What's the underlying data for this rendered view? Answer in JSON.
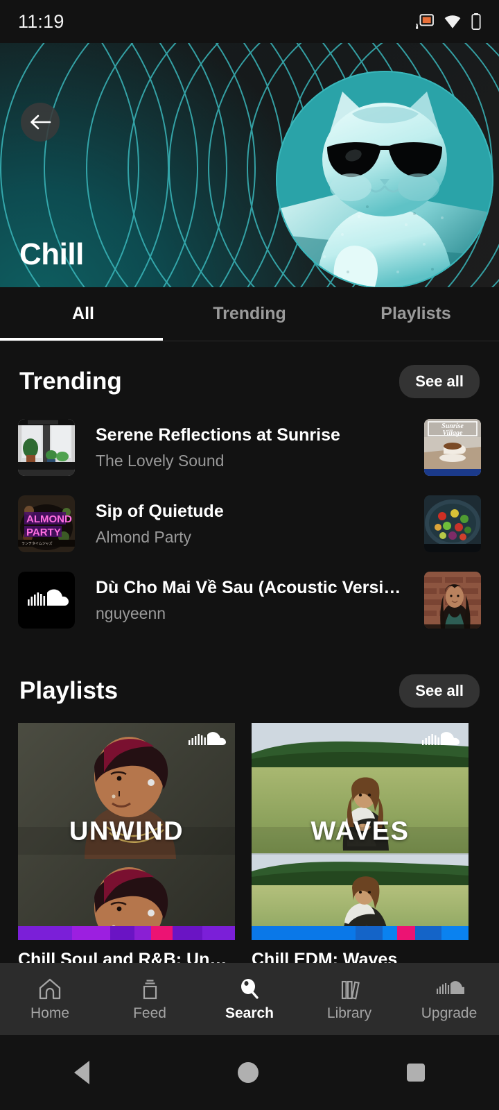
{
  "status_bar": {
    "time": "11:19",
    "icons": [
      "cast-icon",
      "wifi-icon",
      "battery-icon"
    ],
    "cast_color": "#e8703a"
  },
  "hero": {
    "title": "Chill",
    "back_icon": "back-arrow-icon",
    "accent_color": "#2aa3a8",
    "gradient_color": "#0d4b50",
    "artwork_alt": "cool-cat-with-sunglasses"
  },
  "tabs": [
    {
      "label": "All",
      "active": true
    },
    {
      "label": "Trending",
      "active": false
    },
    {
      "label": "Playlists",
      "active": false
    }
  ],
  "trending": {
    "title": "Trending",
    "see_all_label": "See all",
    "tracks": [
      {
        "title": "Serene Reflections at Sunrise",
        "artist": "The Lovely Sound",
        "left_art": "window-plants-artwork",
        "right_art": "sunrise-village-coffee-artwork"
      },
      {
        "title": "Sip of Quietude",
        "artist": "Almond Party",
        "left_art": "almond-party-artwork",
        "right_art": "salad-bowl-artwork"
      },
      {
        "title": "Dù Cho Mai Về Sau (Acoustic Versi…",
        "artist": "nguyeenn",
        "left_art": "soundcloud-logo-artwork",
        "right_art": "woman-brick-wall-artwork"
      }
    ]
  },
  "playlists": {
    "title": "Playlists",
    "see_all_label": "See all",
    "items": [
      {
        "overlay_label": "UNWIND",
        "name": "Chill Soul and R&B: Un…",
        "badge_icon": "soundcloud-cloud-icon",
        "strip_colors": [
          "#7b1fd8",
          "#9c1fe0",
          "#6a14c4",
          "#8a1fd4",
          "#ec1373",
          "#6a14c4",
          "#7b1fd8"
        ]
      },
      {
        "overlay_label": "WAVES",
        "name": "Chill EDM: Waves",
        "badge_icon": "soundcloud-cloud-icon",
        "strip_colors": [
          "#0a78e8",
          "#0a78e8",
          "#1464c8",
          "#0a82f0",
          "#ec1373",
          "#1464c8",
          "#0a82f0"
        ]
      }
    ]
  },
  "bottom_nav": [
    {
      "label": "Home",
      "icon": "home-icon",
      "active": false
    },
    {
      "label": "Feed",
      "icon": "feed-icon",
      "active": false
    },
    {
      "label": "Search",
      "icon": "search-icon",
      "active": true
    },
    {
      "label": "Library",
      "icon": "library-icon",
      "active": false
    },
    {
      "label": "Upgrade",
      "icon": "soundcloud-cloud-icon",
      "active": false
    }
  ],
  "system_nav": {
    "back": "system-back-button",
    "home": "system-home-button",
    "recents": "system-recents-button"
  }
}
